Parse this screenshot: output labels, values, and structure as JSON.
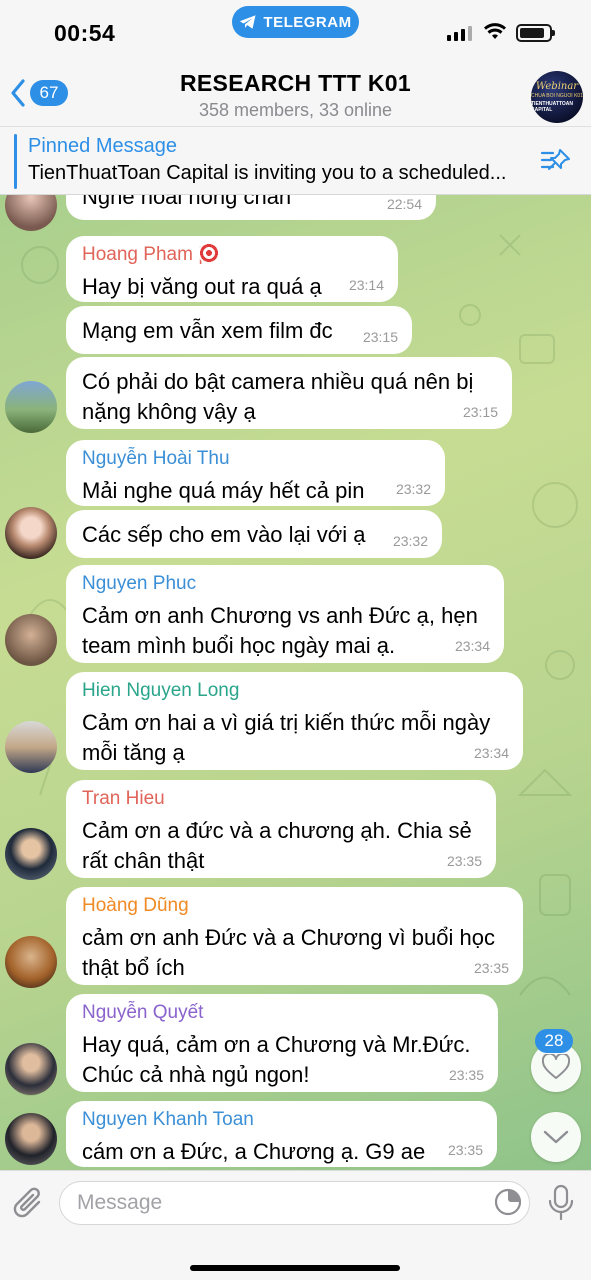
{
  "status_bar": {
    "time": "00:54",
    "app_pill": "TELEGRAM"
  },
  "header": {
    "back_count": "67",
    "title": "RESEARCH TTT K01",
    "subtitle": "358 members, 33 online",
    "avatar_text": [
      "Webinar",
      "CHUA BOI NGUOI K01",
      "TIENTHUATTOAN CAPITAL"
    ]
  },
  "pinned": {
    "label": "Pinned Message",
    "text": "TienThuatToan Capital is inviting you to a scheduled..."
  },
  "messages": [
    {
      "sender": "",
      "sender_color": "",
      "text": "Nghe hoài hông chán",
      "time": "22:54"
    },
    {
      "sender": "Hoang Pham |",
      "sender_color": "#e0645a",
      "text": "Hay bị văng out ra quá ạ",
      "time": "23:14"
    },
    {
      "sender": "",
      "sender_color": "",
      "text": "Mạng em vẫn xem film đc",
      "time": "23:15"
    },
    {
      "sender": "",
      "sender_color": "",
      "text": "Có phải do bật camera nhiều quá nên bị\nnặng không vậy ạ",
      "time": "23:15"
    },
    {
      "sender": "Nguyễn Hoài Thu",
      "sender_color": "#3b8fd6",
      "text": "Mải nghe quá máy hết cả pin",
      "time": "23:32"
    },
    {
      "sender": "",
      "sender_color": "",
      "text": "Các sếp cho em vào lại với ạ",
      "time": "23:32"
    },
    {
      "sender": "Nguyen Phuc",
      "sender_color": "#3b8fd6",
      "text": "Cảm ơn anh Chương vs anh Đức ạ, hẹn\nteam mình buổi học ngày mai ạ.",
      "time": "23:34"
    },
    {
      "sender": "Hien Nguyen Long",
      "sender_color": "#2aa58a",
      "text": "Cảm ơn hai a vì giá trị kiến thức mỗi ngày\nmỗi tăng ạ",
      "time": "23:34"
    },
    {
      "sender": "Tran Hieu",
      "sender_color": "#e0645a",
      "text": "Cảm ơn a đức và a chương ạh. Chia sẻ\nrất chân thật",
      "time": "23:35"
    },
    {
      "sender": "Hoàng Dũng",
      "sender_color": "#f08a24",
      "text": "cảm ơn anh Đức và a Chương vì buổi học\nthật bổ ích",
      "time": "23:35"
    },
    {
      "sender": "Nguyễn Quyết",
      "sender_color": "#8a63cc",
      "text": "Hay quá, cảm ơn a Chương và Mr.Đức.\nChúc cả nhà ngủ ngon!",
      "time": "23:35"
    },
    {
      "sender": "Nguyen Khanh Toan",
      "sender_color": "#3b8fd6",
      "text": "cám ơn a Đức, a Chương ạ. G9 ae",
      "time": "23:35"
    }
  ],
  "reactions_badge": "28",
  "input": {
    "placeholder": "Message"
  },
  "colors": {
    "accent": "#2e8fe6",
    "bubble": "#ffffff",
    "wallpaper": "#b7d48f"
  }
}
